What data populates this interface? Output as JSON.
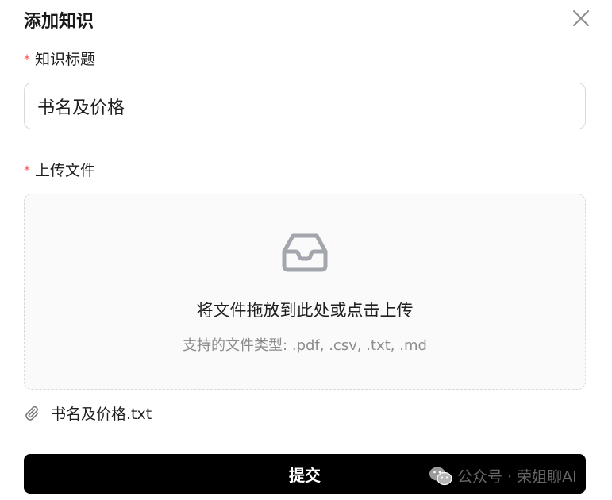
{
  "dialog": {
    "title": "添加知识",
    "close_icon": "close-icon"
  },
  "form": {
    "title_field": {
      "required_mark": "*",
      "label": "知识标题",
      "value": "书名及价格"
    },
    "upload_field": {
      "required_mark": "*",
      "label": "上传文件",
      "dropzone_icon": "inbox-icon",
      "dropzone_title": "将文件拖放到此处或点击上传",
      "dropzone_hint": "支持的文件类型: .pdf, .csv, .txt, .md"
    },
    "uploaded_files": [
      {
        "icon": "paperclip-icon",
        "name": "书名及价格.txt"
      }
    ],
    "submit_label": "提交"
  },
  "watermark": {
    "icon": "wechat-icon",
    "text": "公众号 · 荣姐聊AI"
  },
  "colors": {
    "required": "#ff4d4f",
    "submit_bg": "#000000",
    "hint": "#8c8c8c",
    "icon": "#a3a6ad"
  }
}
